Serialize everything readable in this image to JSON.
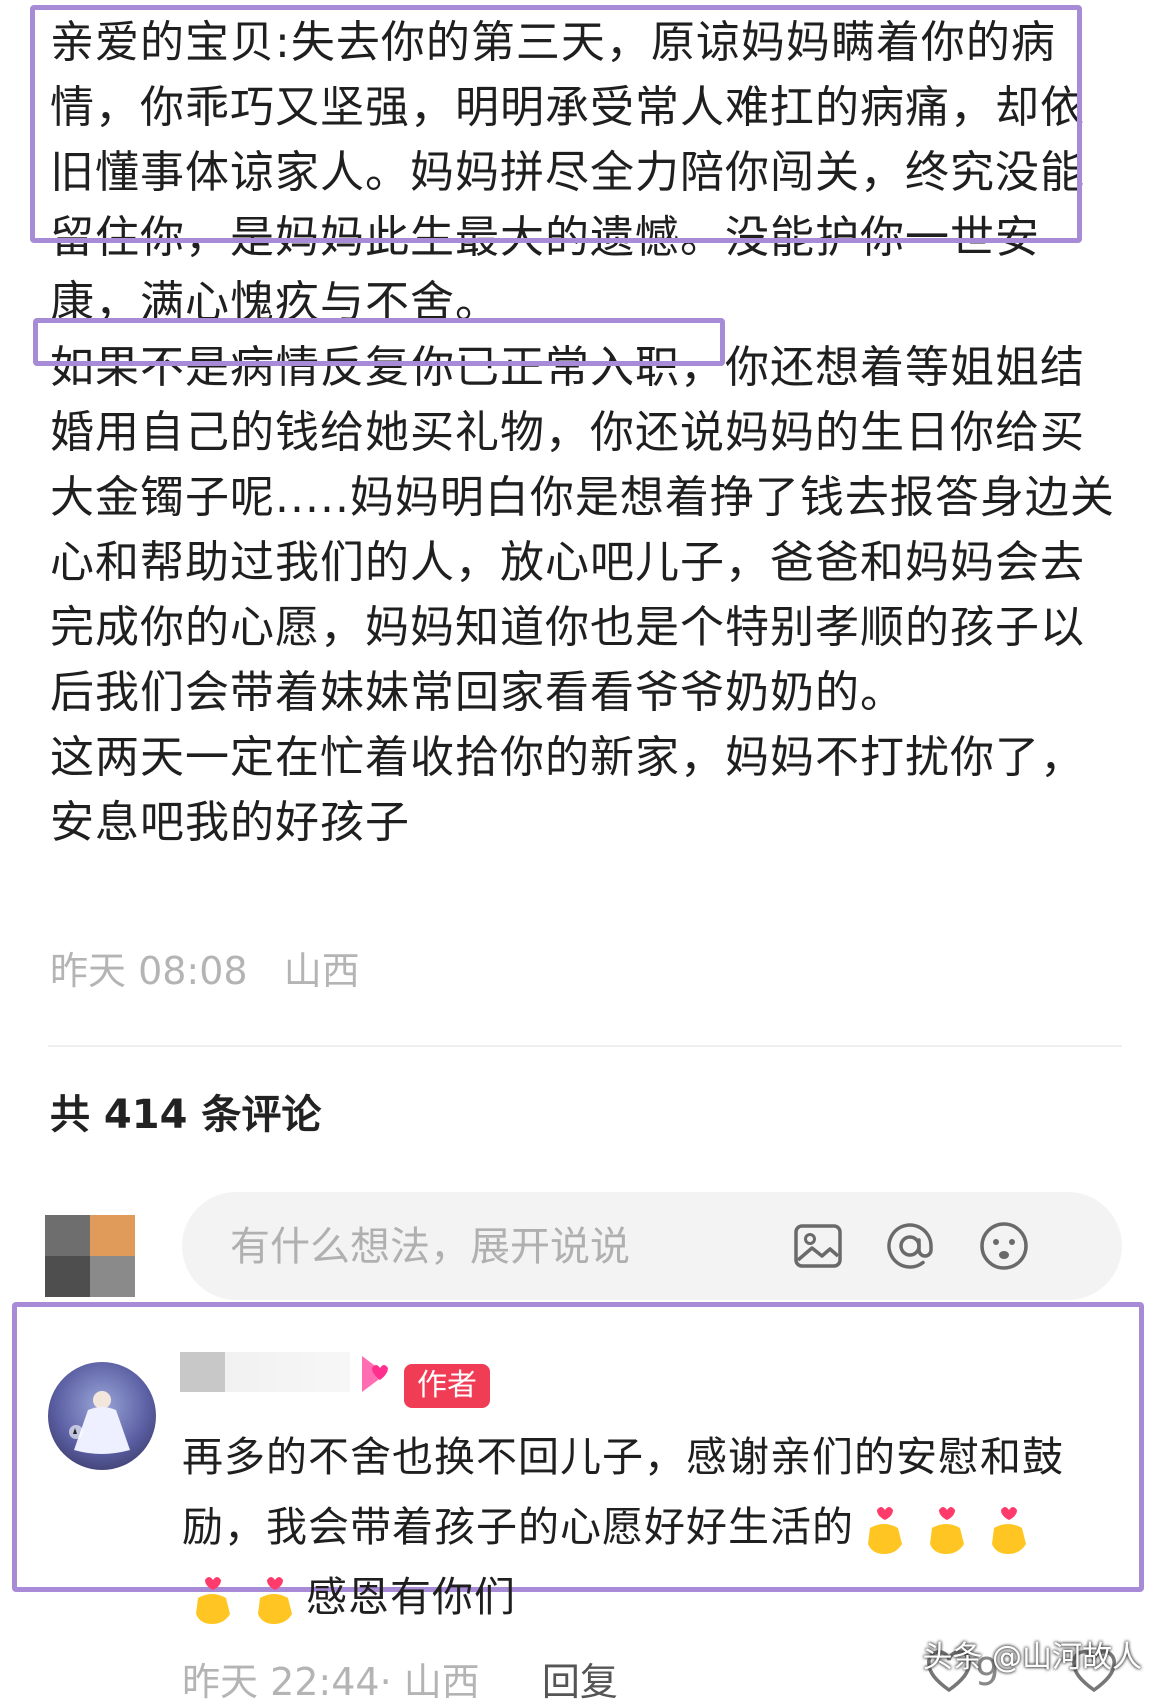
{
  "post": {
    "paragraph_1": "亲爱的宝贝:失去你的第三天，原谅妈妈瞒着你的病情，你乖巧又坚强，明明承受常人难扛的病痛，却依旧懂事体谅家人。妈妈拼尽全力陪你闯关，终究没能留住你，是妈妈此生最大的遗憾。没能护你一世安康，满心愧疚与不舍。",
    "paragraph_2": "如果不是病情反复你已正常入职，你还想着等姐姐结婚用自己的钱给她买礼物，你还说妈妈的生日你给买大金镯子呢.....妈妈明白你是想着挣了钱去报答身边关心和帮助过我们的人，放心吧儿子，爸爸和妈妈会去完成你的心愿，妈妈知道你也是个特别孝顺的孩子以后我们会带着妹妹常回家看看爷爷奶奶的。",
    "paragraph_3": "这两天一定在忙着收拾你的新家，妈妈不打扰你了，安息吧我的好孩子",
    "time": "昨天 08:08",
    "location": "山西"
  },
  "comments": {
    "count_label": "共 414 条评论",
    "input_placeholder": "有什么想法，展开说说",
    "icons": [
      "image-icon",
      "at-icon",
      "emoji-icon"
    ]
  },
  "top_comment": {
    "badge": "作者",
    "text_line_1": "再多的不舍也换不回儿子，感谢亲们的安慰和鼓励，我会带着孩子的心愿好好生活的",
    "text_line_2": "感恩有你们",
    "time_location": "昨天 22:44· 山西",
    "reply_label": "回复",
    "like_count": "9"
  },
  "watermark": "头条 @山河故人",
  "colors": {
    "highlight": "#a78bd6",
    "badge": "#f03c55",
    "meta": "#b4b4b4"
  }
}
